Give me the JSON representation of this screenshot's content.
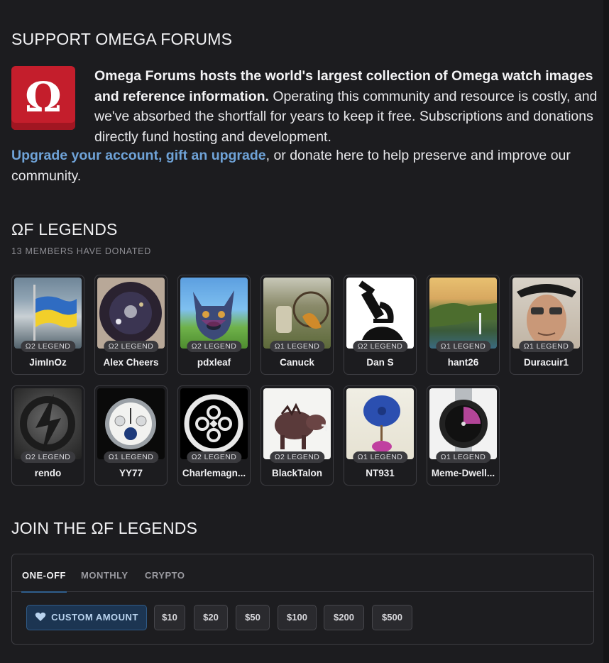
{
  "support": {
    "title": "SUPPORT OMEGA FORUMS",
    "logo_text": "Ω",
    "intro_bold": "Omega Forums hosts the world's largest collection of Omega watch images and reference information.",
    "intro_rest": " Operating this community and resource is costly, and we've absorbed the shortfall for years to keep it free. Subscriptions and donations directly fund hosting and development.",
    "link_text": "Upgrade your account, gift an upgrade",
    "outro_text": ", or donate here to help preserve and improve our community."
  },
  "legends": {
    "title": "ΩF LEGENDS",
    "subtitle": "13 MEMBERS HAVE DONATED",
    "members": [
      {
        "name": "JimInOz",
        "badge": "Ω2 LEGEND"
      },
      {
        "name": "Alex Cheers",
        "badge": "Ω2 LEGEND"
      },
      {
        "name": "pdxleaf",
        "badge": "Ω2 LEGEND"
      },
      {
        "name": "Canuck",
        "badge": "Ω1 LEGEND"
      },
      {
        "name": "Dan S",
        "badge": "Ω2 LEGEND"
      },
      {
        "name": "hant26",
        "badge": "Ω1 LEGEND"
      },
      {
        "name": "Duracuir1",
        "badge": "Ω1 LEGEND"
      },
      {
        "name": "rendo",
        "badge": "Ω2 LEGEND"
      },
      {
        "name": "YY77",
        "badge": "Ω1 LEGEND"
      },
      {
        "name": "Charlemagn...",
        "badge": "Ω2 LEGEND"
      },
      {
        "name": "BlackTalon",
        "badge": "Ω2 LEGEND"
      },
      {
        "name": "NT931",
        "badge": "Ω1 LEGEND"
      },
      {
        "name": "Meme-Dwell...",
        "badge": "Ω1 LEGEND"
      }
    ]
  },
  "join": {
    "title": "JOIN THE ΩF LEGENDS",
    "tabs": [
      "ONE-OFF",
      "MONTHLY",
      "CRYPTO"
    ],
    "active_tab": "ONE-OFF",
    "custom_label": "CUSTOM AMOUNT",
    "amounts": [
      "$10",
      "$20",
      "$50",
      "$100",
      "$200",
      "$500"
    ]
  }
}
